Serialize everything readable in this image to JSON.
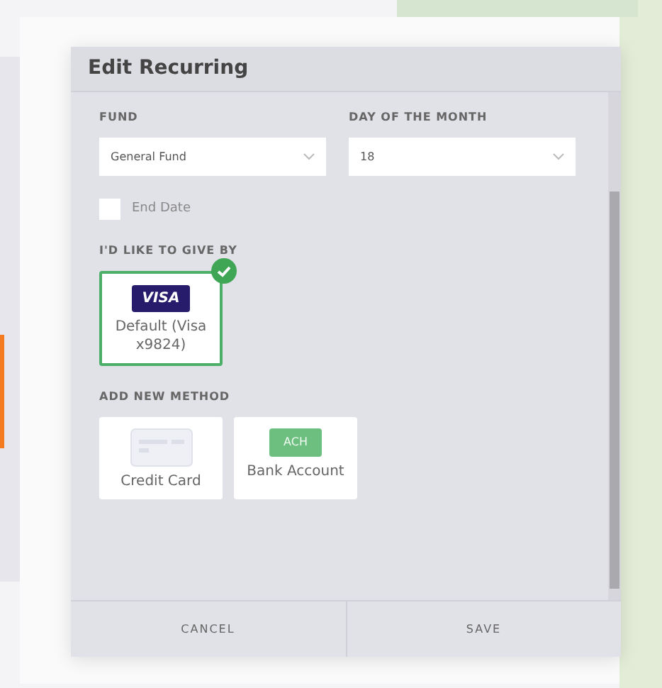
{
  "dialog": {
    "title": "Edit Recurring",
    "fields": [
      {
        "label": "FUND",
        "value": "General Fund"
      },
      {
        "label": "DAY OF THE MONTH",
        "value": "18"
      }
    ],
    "end_date": {
      "label": "End Date",
      "checked": false
    },
    "give_by": {
      "heading": "I'D LIKE TO GIVE BY",
      "methods": [
        {
          "badge": "VISA",
          "label": "Default (Visa x9824)",
          "selected": true
        }
      ]
    },
    "add_new": {
      "heading": "ADD NEW METHOD",
      "methods": [
        {
          "kind": "card",
          "label": "Credit Card"
        },
        {
          "kind": "bank",
          "badge": "ACH",
          "label": "Bank Account"
        }
      ]
    },
    "buttons": [
      "CANCEL",
      "SAVE"
    ]
  }
}
